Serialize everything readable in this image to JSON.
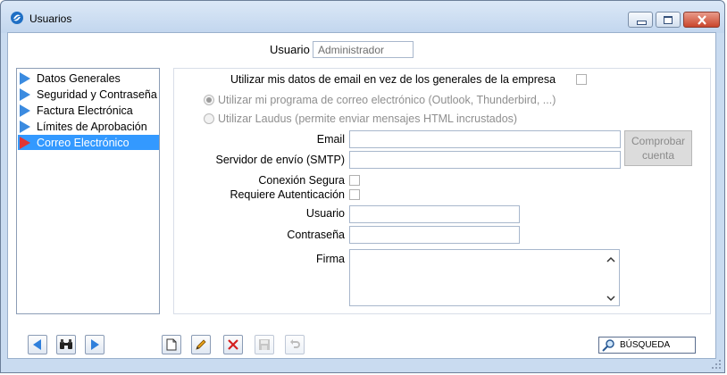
{
  "window": {
    "title": "Usuarios"
  },
  "user": {
    "label": "Usuario",
    "value": "Administrador"
  },
  "tree": {
    "items": [
      {
        "label": "Datos Generales"
      },
      {
        "label": "Seguridad y Contraseña"
      },
      {
        "label": "Factura Electrónica"
      },
      {
        "label": "Límites de Aprobación"
      },
      {
        "label": "Correo Electrónico",
        "selected": true
      }
    ]
  },
  "form": {
    "use_my_email_label": "Utilizar mis datos de email en vez de los generales de la empresa",
    "radio_mail_program": "Utilizar mi programa de correo electrónico (Outlook, Thunderbird, ...)",
    "radio_laudus": "Utilizar Laudus (permite enviar mensajes HTML incrustados)",
    "email_label": "Email",
    "smtp_label": "Servidor de envío (SMTP)",
    "check_button_line1": "Comprobar",
    "check_button_line2": "cuenta",
    "secure_label": "Conexión Segura",
    "auth_label": "Requiere Autenticación",
    "user_label": "Usuario",
    "password_label": "Contraseña",
    "signature_label": "Firma"
  },
  "toolbar": {
    "search_label": "BÚSQUEDA"
  },
  "colors": {
    "accent": "#3399ff",
    "selected_arrow": "#e03535",
    "nav_arrow": "#3b8be0"
  }
}
